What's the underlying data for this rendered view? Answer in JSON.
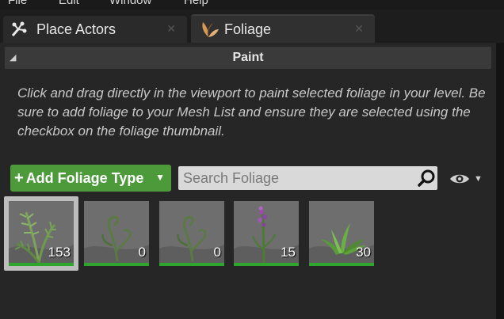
{
  "menubar": {
    "items": [
      "File",
      "Edit",
      "Window",
      "Help"
    ]
  },
  "tabs": [
    {
      "label": "Place Actors",
      "icon": "place-actors-icon",
      "active": false
    },
    {
      "label": "Foliage",
      "icon": "foliage-icon",
      "active": true
    }
  ],
  "section": {
    "title": "Paint"
  },
  "description": "Click and drag directly in the viewport to paint selected foliage in your level. Be sure to add foliage to your Mesh List and ensure they are selected using the checkbox on the foliage thumbnail.",
  "toolbar": {
    "add_label": "Add Foliage Type",
    "search_placeholder": "Search Foliage",
    "accent_color": "#4d9a3a"
  },
  "foliage_types": [
    {
      "count": "153",
      "kind": "fern",
      "selected": true
    },
    {
      "count": "0",
      "kind": "curl",
      "selected": false
    },
    {
      "count": "0",
      "kind": "curl",
      "selected": false
    },
    {
      "count": "15",
      "kind": "flower",
      "selected": false
    },
    {
      "count": "30",
      "kind": "grass",
      "selected": false
    }
  ]
}
